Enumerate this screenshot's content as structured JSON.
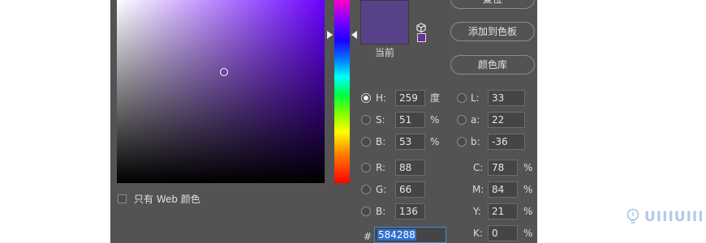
{
  "picker": {
    "color_field_hue_hex": "#6a00ff",
    "current_swatch_hex": "#584288",
    "current_label": "当前"
  },
  "buttons": {
    "top_partial": "复位",
    "add_to_swatches": "添加到色板",
    "color_library": "颜色库"
  },
  "web_only": {
    "label": "只有 Web 颜色",
    "checked": false
  },
  "hsb": [
    {
      "label": "H:",
      "value": "259",
      "unit": "度",
      "selected": true
    },
    {
      "label": "S:",
      "value": "51",
      "unit": "%",
      "selected": false
    },
    {
      "label": "B:",
      "value": "53",
      "unit": "%",
      "selected": false
    }
  ],
  "lab": [
    {
      "label": "L:",
      "value": "33"
    },
    {
      "label": "a:",
      "value": "22"
    },
    {
      "label": "b:",
      "value": "-36"
    }
  ],
  "rgb": [
    {
      "label": "R:",
      "value": "88"
    },
    {
      "label": "G:",
      "value": "66"
    },
    {
      "label": "B:",
      "value": "136"
    }
  ],
  "cmyk": [
    {
      "label": "C:",
      "value": "78",
      "unit": "%"
    },
    {
      "label": "M:",
      "value": "84",
      "unit": "%"
    },
    {
      "label": "Y:",
      "value": "21",
      "unit": "%"
    },
    {
      "label": "K:",
      "value": "0",
      "unit": "%"
    }
  ],
  "hex": {
    "label": "#",
    "value": "584288"
  },
  "watermark": "UIIIUIII"
}
